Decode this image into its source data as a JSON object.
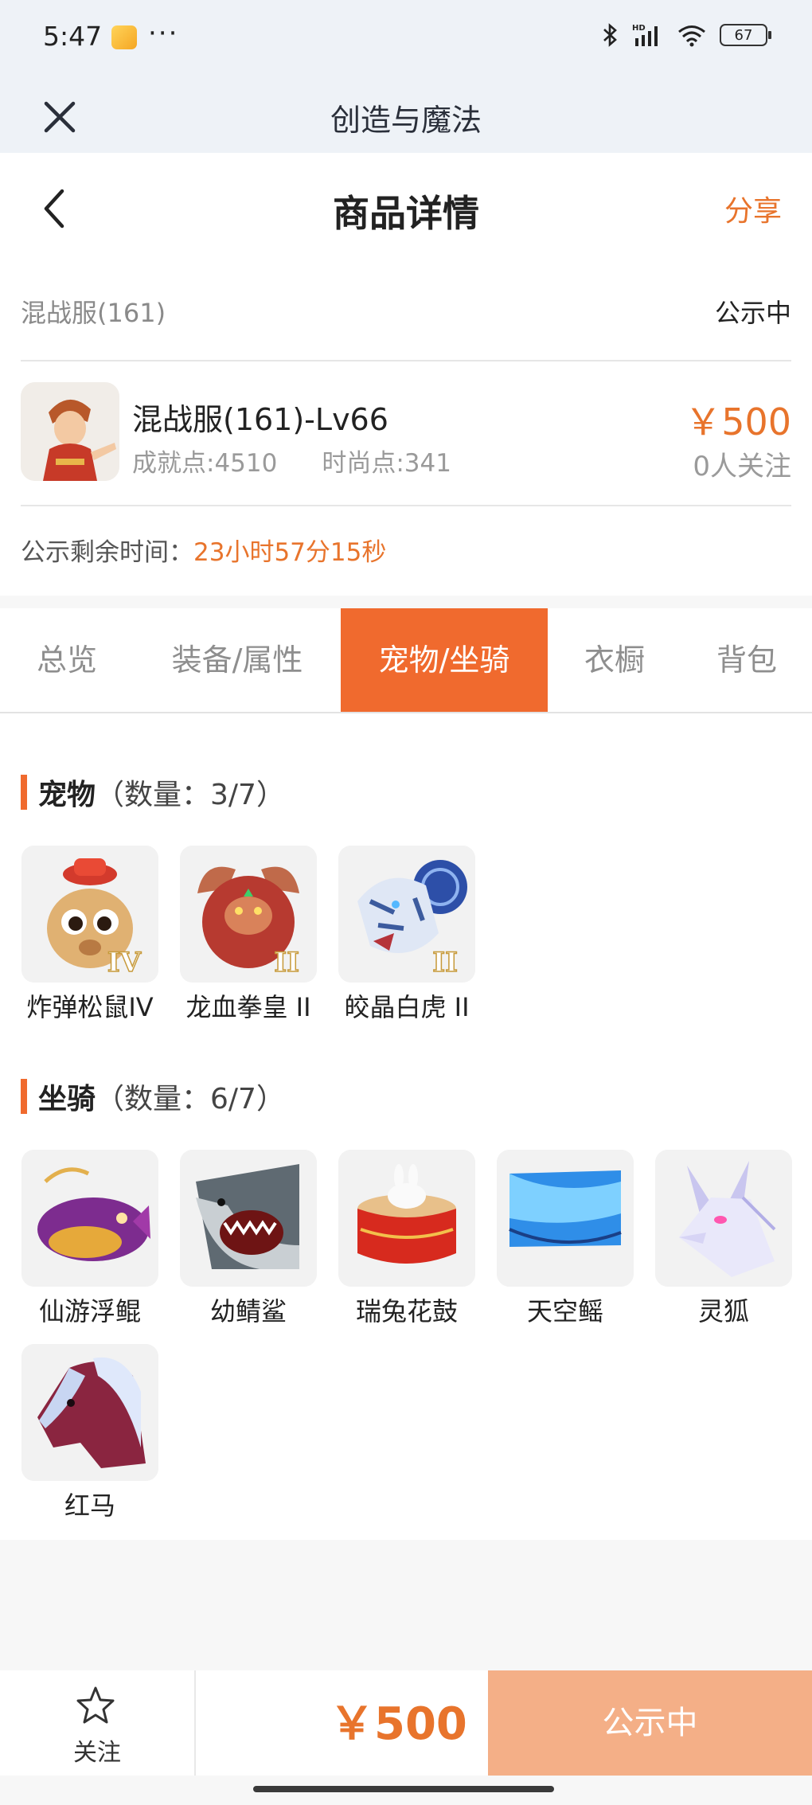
{
  "status_bar": {
    "time": "5:47",
    "more": "···",
    "network": "HD",
    "battery": "67"
  },
  "app_bar": {
    "title": "创造与魔法"
  },
  "header": {
    "title": "商品详情",
    "share_label": "分享"
  },
  "summary": {
    "server": "混战服(161)",
    "status": "公示中",
    "item_name": "混战服(161)-Lv66",
    "achievement": "成就点:4510",
    "fashion": "时尚点:341",
    "price": "￥500",
    "followers": "0人关注",
    "timer_label": "公示剩余时间：",
    "timer_value": "23小时57分15秒"
  },
  "tabs": [
    {
      "label": "总览",
      "active": false
    },
    {
      "label": "装备/属性",
      "active": false
    },
    {
      "label": "宠物/坐骑",
      "active": true
    },
    {
      "label": "衣橱",
      "active": false
    },
    {
      "label": "背包",
      "active": false
    }
  ],
  "pets": {
    "title": "宠物",
    "count": "（数量：3/7）",
    "items": [
      {
        "name": "炸弹松鼠IV",
        "badge": "IV"
      },
      {
        "name": "龙血拳皇 II",
        "badge": "II"
      },
      {
        "name": "皎晶白虎 II",
        "badge": "II"
      }
    ]
  },
  "mounts": {
    "title": "坐骑",
    "count": "（数量：6/7）",
    "items": [
      {
        "name": "仙游浮鲲"
      },
      {
        "name": "幼鲭鲨"
      },
      {
        "name": "瑞兔花鼓"
      },
      {
        "name": "天空鳐"
      },
      {
        "name": "灵狐"
      },
      {
        "name": "红马"
      }
    ]
  },
  "bottom_bar": {
    "follow_label": "关注",
    "price": "￥500",
    "action_label": "公示中"
  },
  "colors": {
    "accent": "#f06a2e",
    "price": "#e8742c",
    "action_disabled": "#f4af87"
  }
}
